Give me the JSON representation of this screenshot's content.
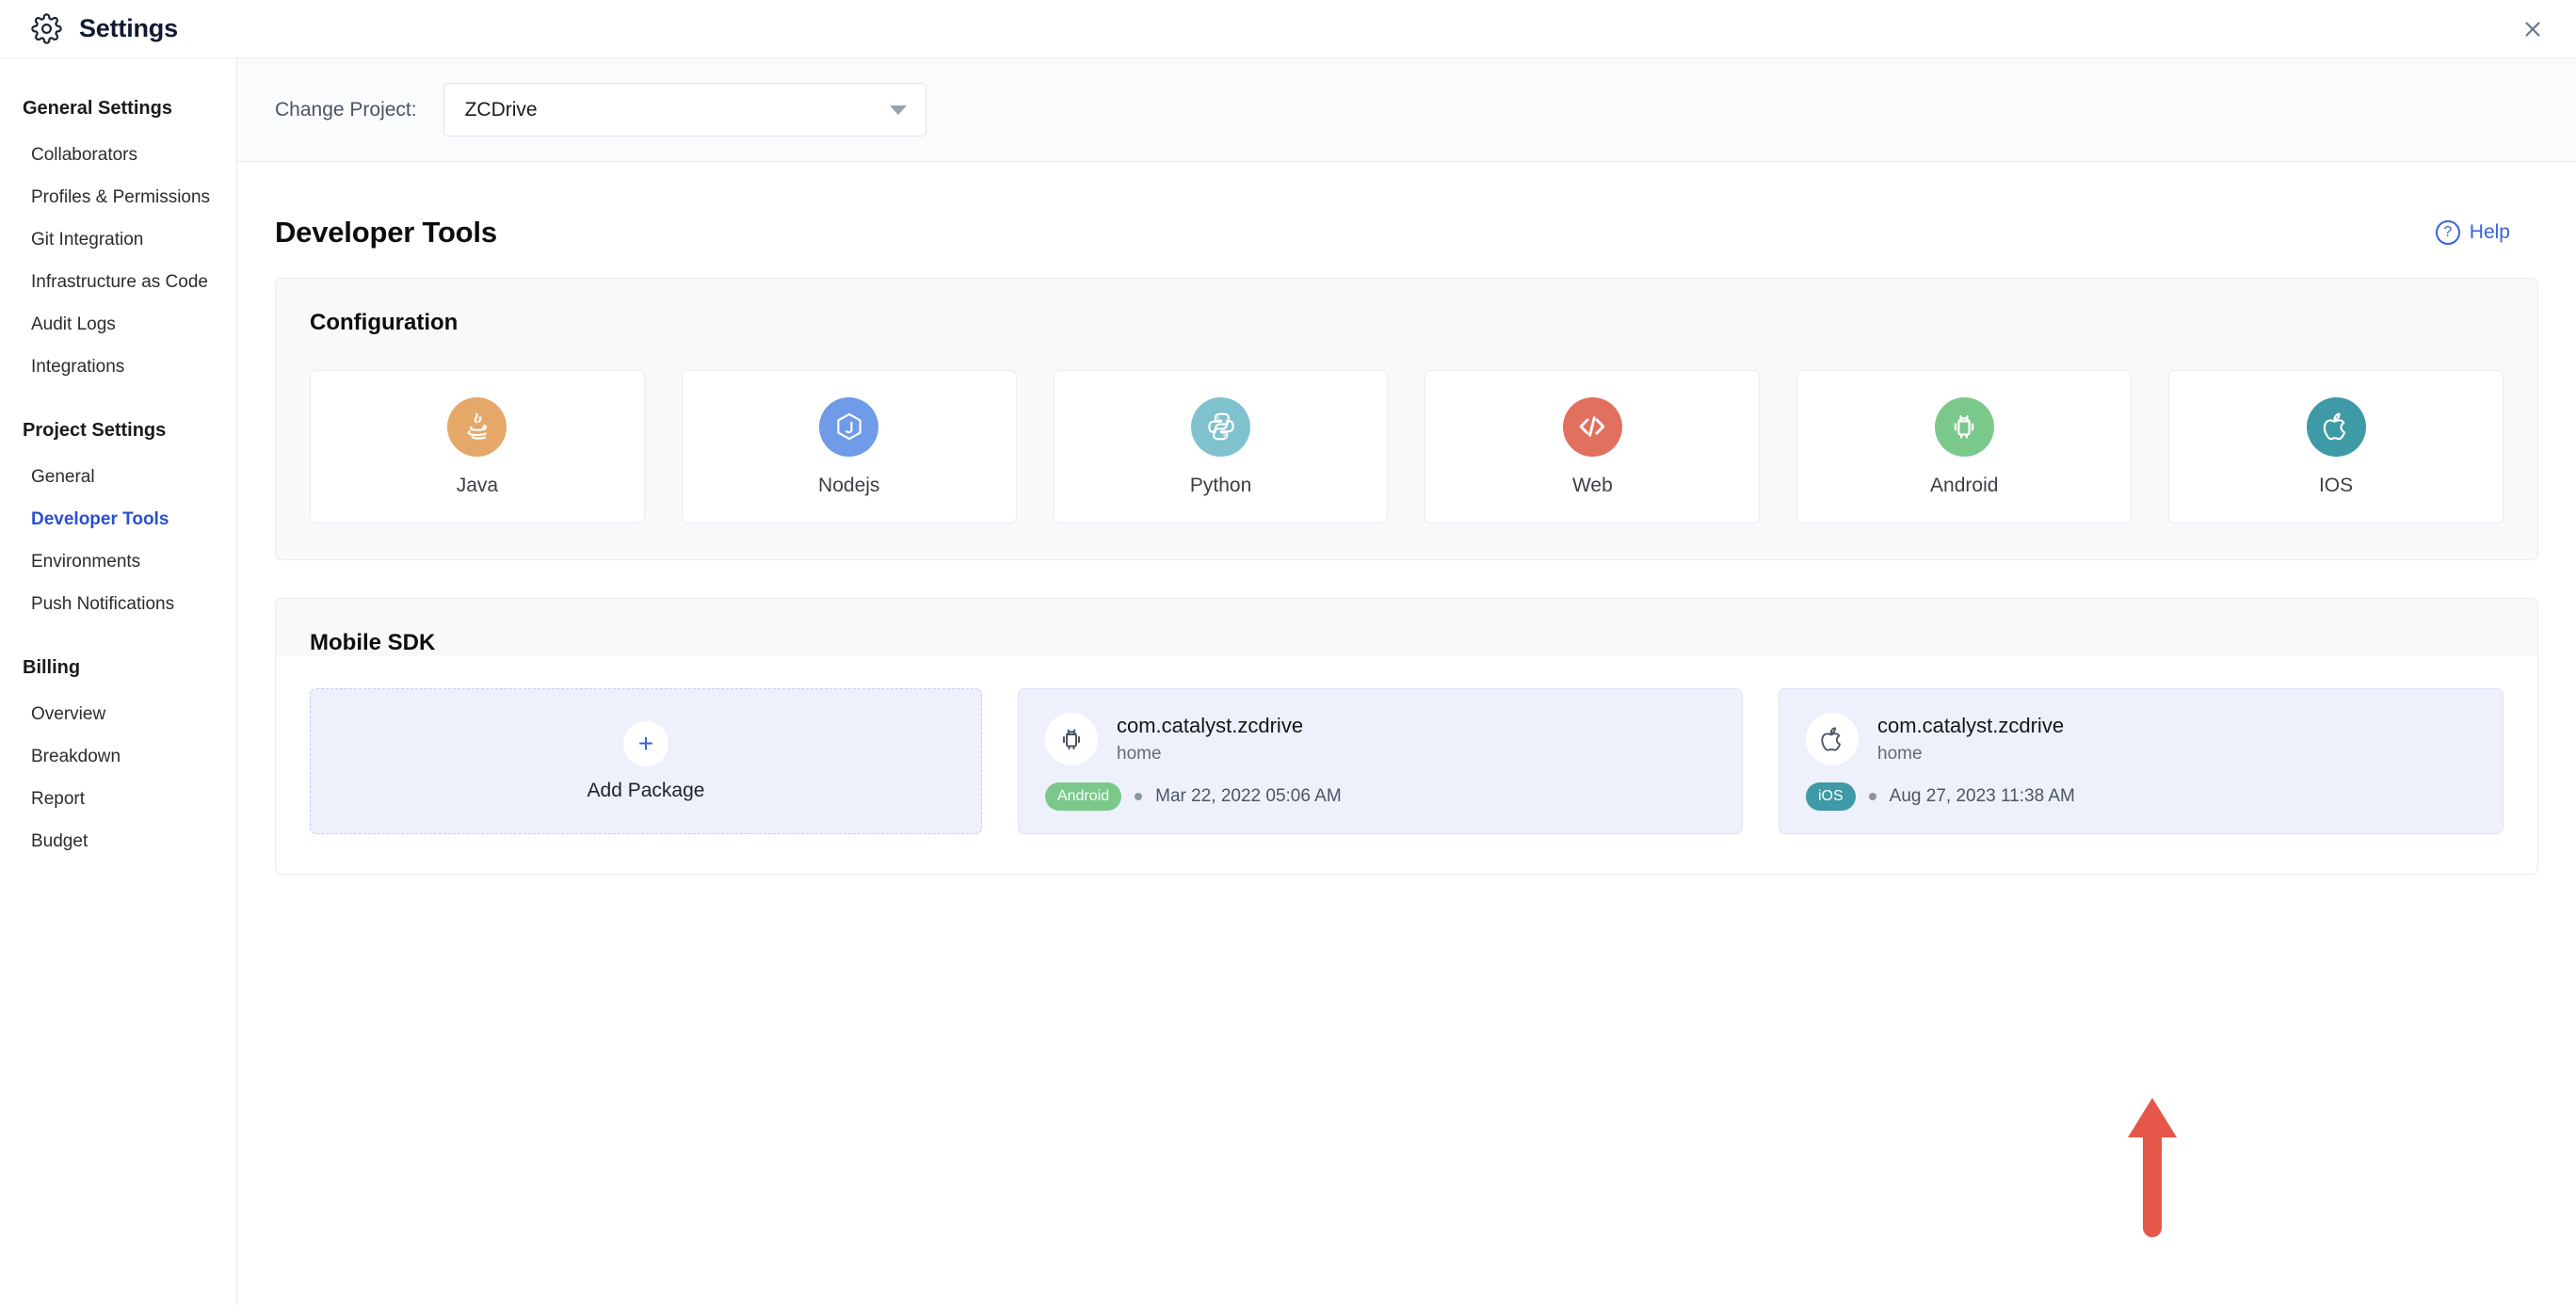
{
  "window": {
    "title": "Settings",
    "gear_icon": "gear-icon",
    "close_icon": "close-icon"
  },
  "sidebar": {
    "groups": [
      {
        "title": "General Settings",
        "items": [
          {
            "label": "Collaborators",
            "active": false
          },
          {
            "label": "Profiles & Permissions",
            "active": false
          },
          {
            "label": "Git Integration",
            "active": false
          },
          {
            "label": "Infrastructure as Code",
            "active": false
          },
          {
            "label": "Audit Logs",
            "active": false
          },
          {
            "label": "Integrations",
            "active": false
          }
        ]
      },
      {
        "title": "Project Settings",
        "items": [
          {
            "label": "General",
            "active": false
          },
          {
            "label": "Developer Tools",
            "active": true
          },
          {
            "label": "Environments",
            "active": false
          },
          {
            "label": "Push Notifications",
            "active": false
          }
        ]
      },
      {
        "title": "Billing",
        "items": [
          {
            "label": "Overview",
            "active": false
          },
          {
            "label": "Breakdown",
            "active": false
          },
          {
            "label": "Report",
            "active": false
          },
          {
            "label": "Budget",
            "active": false
          }
        ]
      }
    ]
  },
  "project_bar": {
    "label": "Change Project:",
    "selected_project": "ZCDrive",
    "caret_icon": "chevron-down-icon"
  },
  "page": {
    "title": "Developer Tools",
    "help_label": "Help",
    "help_icon": "question-circle-icon"
  },
  "configuration": {
    "title": "Configuration",
    "cards": [
      {
        "label": "Java",
        "icon": "java-icon",
        "color": "#e5a869"
      },
      {
        "label": "Nodejs",
        "icon": "nodejs-icon",
        "color": "#6f9be8"
      },
      {
        "label": "Python",
        "icon": "python-icon",
        "color": "#7fc2ce"
      },
      {
        "label": "Web",
        "icon": "code-icon",
        "color": "#e1705f"
      },
      {
        "label": "Android",
        "icon": "android-icon",
        "color": "#7ac98b"
      },
      {
        "label": "IOS",
        "icon": "apple-icon",
        "color": "#3d9aa6"
      }
    ]
  },
  "mobile_sdk": {
    "title": "Mobile SDK",
    "add_package": {
      "label": "Add Package",
      "icon": "plus-icon"
    },
    "packages": [
      {
        "name": "com.catalyst.zcdrive",
        "environment": "home",
        "platform": "Android",
        "platform_color": "#7ac98b",
        "icon": "android-icon",
        "timestamp": "Mar 22, 2022 05:06 AM"
      },
      {
        "name": "com.catalyst.zcdrive",
        "environment": "home",
        "platform": "iOS",
        "platform_color": "#3d9aa6",
        "icon": "apple-icon",
        "timestamp": "Aug 27, 2023 11:38 AM"
      }
    ]
  },
  "annotation": {
    "arrow_icon": "up-arrow-annotation",
    "color": "#e4574a"
  }
}
